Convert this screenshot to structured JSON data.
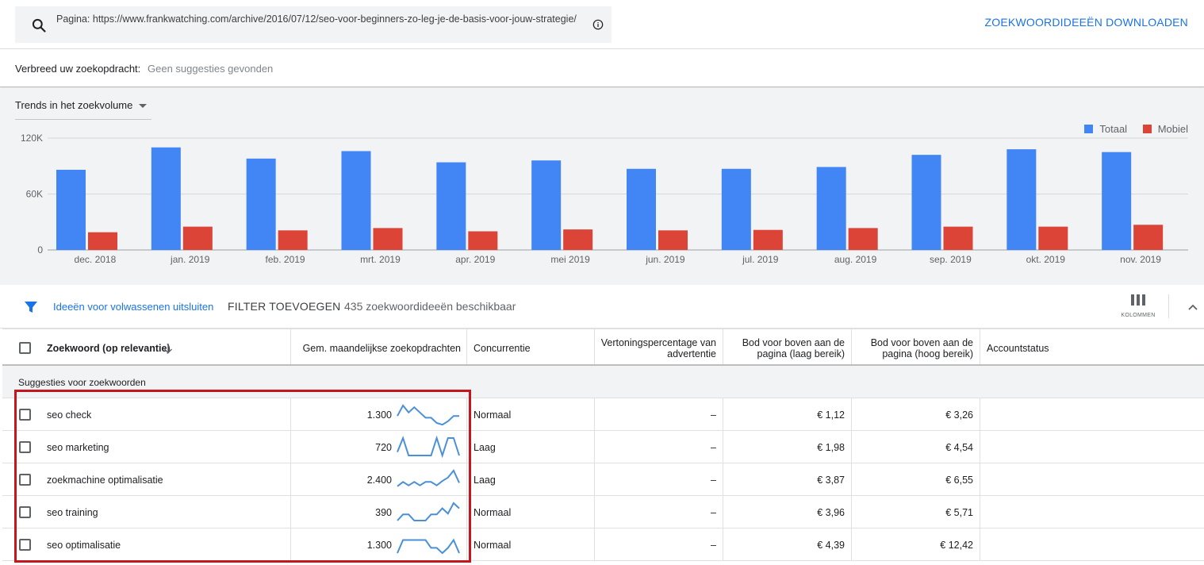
{
  "search": {
    "text": "Pagina: https://www.frankwatching.com/archive/2016/07/12/seo-voor-beginners-zo-leg-je-de-basis-voor-jouw-strategie/",
    "download_label": "ZOEKWOORDIDEEËN DOWNLOADEN"
  },
  "broaden": {
    "label": "Verbreed uw zoekopdracht:",
    "value": "Geen suggesties gevonden"
  },
  "chart_select": "Trends in het zoekvolume",
  "chart_data": {
    "type": "bar",
    "categories": [
      "dec. 2018",
      "jan. 2019",
      "feb. 2019",
      "mrt. 2019",
      "apr. 2019",
      "mei 2019",
      "jun. 2019",
      "jul. 2019",
      "aug. 2019",
      "sep. 2019",
      "okt. 2019",
      "nov. 2019"
    ],
    "series": [
      {
        "name": "Totaal",
        "color": "#4285f4",
        "values": [
          86000,
          110000,
          98000,
          106000,
          94000,
          96000,
          87000,
          87000,
          89000,
          102000,
          108000,
          105000
        ]
      },
      {
        "name": "Mobiel",
        "color": "#db4437",
        "values": [
          19000,
          25000,
          21000,
          23500,
          20000,
          22000,
          21000,
          21500,
          23500,
          25000,
          25000,
          27000
        ]
      }
    ],
    "yticks": [
      "120K",
      "60K",
      "0"
    ],
    "ylim": [
      0,
      120000
    ],
    "grid": true,
    "legend": "top-right"
  },
  "filterbar": {
    "adult_label": "Ideeën voor volwassenen uitsluiten",
    "add_filter_label": "FILTER TOEVOEGEN",
    "count_label": "435 zoekwoordideeën beschikbaar",
    "columns_label": "KOLOMMEN"
  },
  "table": {
    "headers": {
      "keyword": "Zoekwoord (op relevantie)",
      "volume": "Gem. maandelijkse zoekopdrachten",
      "competition": "Concurrentie",
      "impression_1": "Vertoningspercentage van",
      "impression_2": "advertentie",
      "bid_low_1": "Bod voor boven aan de",
      "bid_low_2": "pagina (laag bereik)",
      "bid_high_1": "Bod voor boven aan de",
      "bid_high_2": "pagina (hoog bereik)",
      "status": "Accountstatus"
    },
    "group_label": "Suggesties voor zoekwoorden",
    "rows": [
      {
        "keyword": "seo check",
        "volume": "1.300",
        "competition": "Normaal",
        "impression": "–",
        "bid_low": "€ 1,12",
        "bid_high": "€ 3,26",
        "trend": [
          0.4,
          1.0,
          0.6,
          0.9,
          0.6,
          0.3,
          0.3,
          0.0,
          -0.1,
          0.1,
          0.4,
          0.4
        ]
      },
      {
        "keyword": "seo marketing",
        "volume": "720",
        "competition": "Laag",
        "impression": "–",
        "bid_low": "€ 1,98",
        "bid_high": "€ 4,54",
        "trend": [
          0.2,
          1.0,
          0.0,
          0.0,
          0.0,
          0.0,
          0.0,
          1.0,
          0.0,
          1.0,
          1.0,
          0.0
        ]
      },
      {
        "keyword": "zoekmachine optimalisatie",
        "volume": "2.400",
        "competition": "Laag",
        "impression": "–",
        "bid_low": "€ 3,87",
        "bid_high": "€ 6,55",
        "trend": [
          0.1,
          0.35,
          0.15,
          0.35,
          0.15,
          0.35,
          0.35,
          0.15,
          0.4,
          0.6,
          1.0,
          0.3
        ]
      },
      {
        "keyword": "seo training",
        "volume": "390",
        "competition": "Normaal",
        "impression": "–",
        "bid_low": "€ 3,96",
        "bid_high": "€ 5,71",
        "trend": [
          0.0,
          0.35,
          0.35,
          0.0,
          0.0,
          0.0,
          0.35,
          0.35,
          0.7,
          0.4,
          1.0,
          0.7
        ]
      },
      {
        "keyword": "seo optimalisatie",
        "volume": "1.300",
        "competition": "Normaal",
        "impression": "–",
        "bid_low": "€ 4,39",
        "bid_high": "€ 12,42",
        "trend": [
          0.0,
          0.75,
          0.75,
          0.75,
          0.75,
          0.75,
          0.3,
          0.3,
          0.0,
          0.3,
          0.75,
          0.0
        ]
      }
    ]
  }
}
